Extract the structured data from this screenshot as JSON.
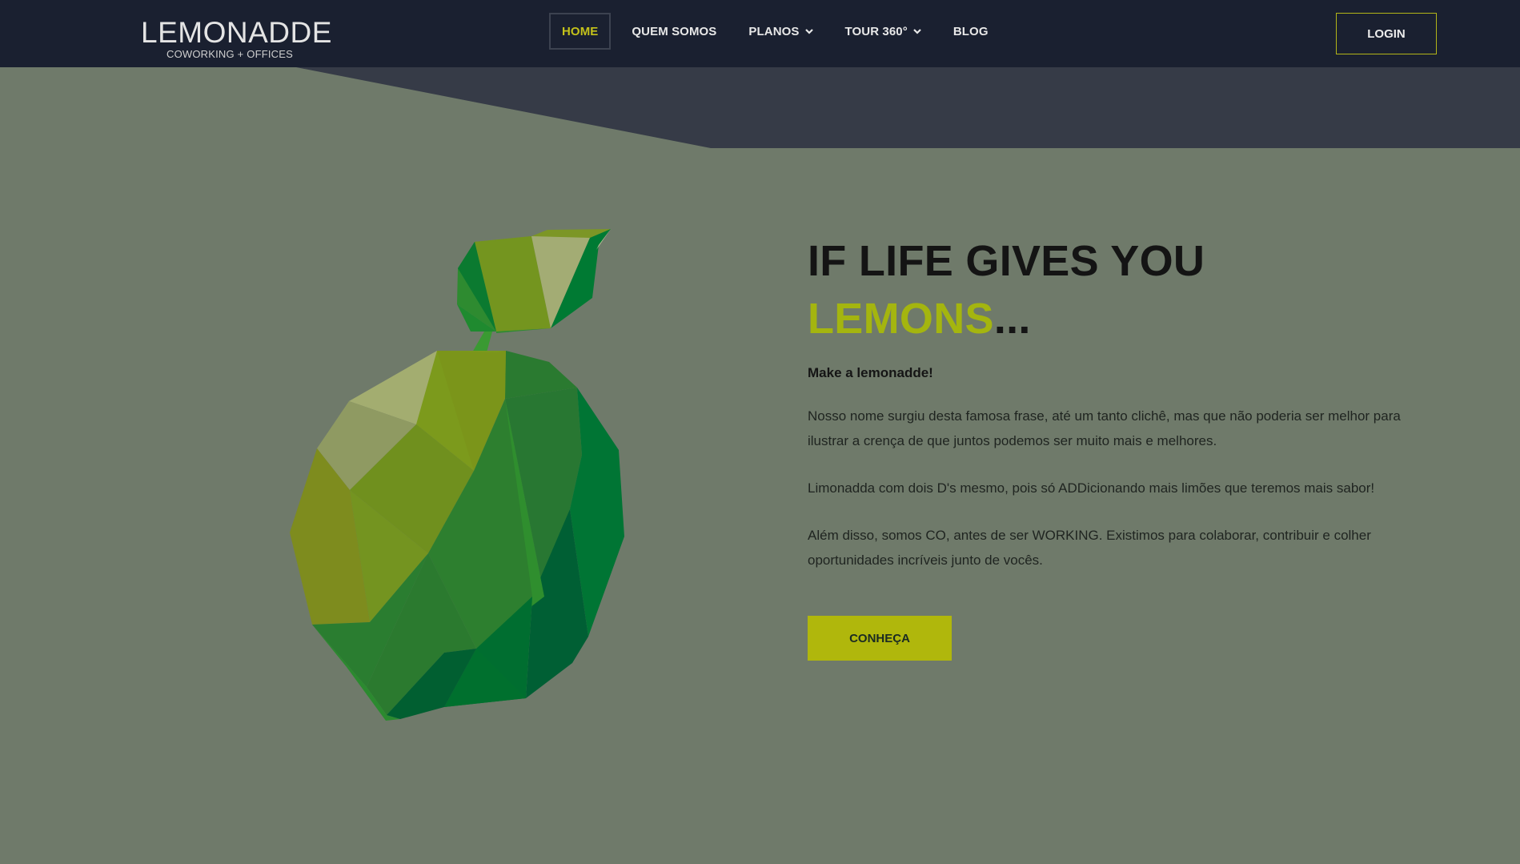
{
  "header": {
    "logo_main": "LEMONADDE",
    "logo_sub": "COWORKING + OFFICES",
    "nav": [
      {
        "label": "HOME",
        "active": true
      },
      {
        "label": "QUEM SOMOS"
      },
      {
        "label": "PLANOS",
        "dropdown": true
      },
      {
        "label": "TOUR 360°",
        "dropdown": true
      },
      {
        "label": "BLOG"
      }
    ],
    "login_label": "LOGIN"
  },
  "hero": {
    "title_line1": "IF LIFE GIVES YOU",
    "title_highlight": "LEMONS",
    "title_suffix": "...",
    "subhead": "Make a lemonadde!",
    "paragraphs": [
      "Nosso nome surgiu desta famosa frase, até um tanto clichê, mas que não poderia ser melhor para ilustrar a crença de que juntos podemos ser muito mais e melhores.",
      "Limonadda com dois D's mesmo, pois só ADDicionando mais limões que teremos mais sabor!",
      "Além disso, somos CO, antes de ser WORKING. Existimos para colaborar, contribuir e colher oportunidades incríveis junto de vocês."
    ],
    "cta_label": "CONHEÇA"
  },
  "colors": {
    "header_bg": "#1a2030",
    "page_bg": "#6f7a6a",
    "accent": "#b0b70c",
    "highlight_text": "#a4b50f"
  },
  "icons": {
    "lemon_illustration": "low-poly-lime-icon",
    "dropdown": "chevron-down-icon"
  }
}
